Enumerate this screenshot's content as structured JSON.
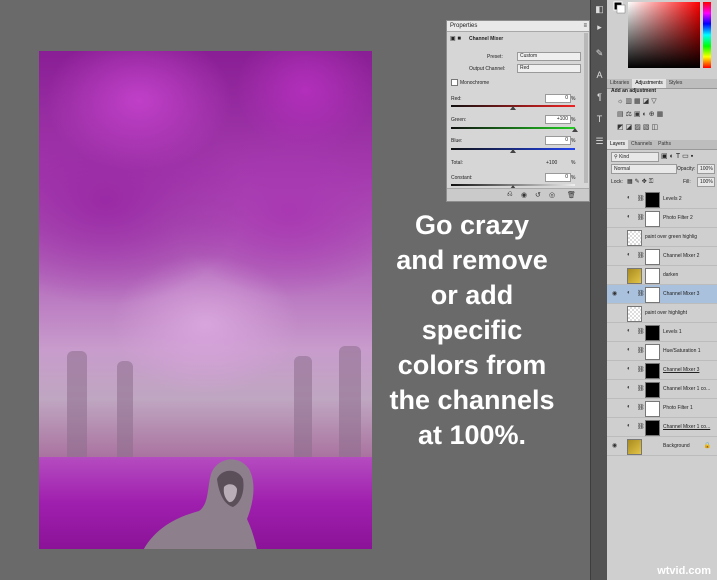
{
  "caption": {
    "lines": [
      "Go crazy",
      "and remove",
      "or add",
      "specific",
      "colors from",
      "the channels",
      "at 100%."
    ]
  },
  "properties": {
    "title": "Properties",
    "panel_name": "Channel Mixer",
    "preset_label": "Preset:",
    "preset_value": "Custom",
    "output_label": "Output Channel:",
    "output_value": "Red",
    "monochrome_label": "Monochrome",
    "red_label": "Red:",
    "red_value": "0",
    "green_label": "Green:",
    "green_value": "+100",
    "blue_label": "Blue:",
    "blue_value": "0",
    "total_label": "Total:",
    "total_value": "+100",
    "constant_label": "Constant:",
    "constant_value": "0",
    "pct": "%",
    "slider_levels": {
      "red": 0.5,
      "green": 1.0,
      "blue": 0.5,
      "constant": 0.5
    }
  },
  "dock": {
    "tabs_top": [
      "Libraries",
      "Adjustments",
      "Styles"
    ],
    "adjust_title": "Add an adjustment",
    "tabs_layers": [
      "Layers",
      "Channels",
      "Paths"
    ],
    "kind_label": "Kind",
    "blend_mode": "Normal",
    "opacity_label": "Opacity:",
    "opacity_value": "100%",
    "lock_label": "Lock:",
    "fill_label": "Fill:",
    "fill_value": "100%",
    "layers": [
      {
        "name": "Levels 2",
        "type": "adjust",
        "thumb": "black",
        "visible": false,
        "selected": false,
        "underline": false
      },
      {
        "name": "Photo Filter 2",
        "type": "adjust",
        "thumb": "white",
        "visible": false,
        "selected": false,
        "underline": false
      },
      {
        "name": "paint over green highlight",
        "type": "pixel",
        "thumb": "checker",
        "visible": false,
        "selected": false,
        "underline": false
      },
      {
        "name": "Channel Mixer 2",
        "type": "adjust",
        "thumb": "white",
        "visible": false,
        "selected": false,
        "underline": false
      },
      {
        "name": "darken",
        "type": "image",
        "thumb": "white",
        "visible": false,
        "selected": false,
        "underline": false
      },
      {
        "name": "Channel Mixer 3",
        "type": "adjust",
        "thumb": "white",
        "visible": true,
        "selected": true,
        "underline": false
      },
      {
        "name": "paint over highlight",
        "type": "pixel",
        "thumb": "checker",
        "visible": false,
        "selected": false,
        "underline": false
      },
      {
        "name": "Levels 1",
        "type": "adjust",
        "thumb": "black",
        "visible": false,
        "selected": false,
        "underline": false
      },
      {
        "name": "Hue/Saturation 1",
        "type": "adjust",
        "thumb": "white",
        "visible": false,
        "selected": false,
        "underline": false
      },
      {
        "name": "Channel Mixer 3",
        "type": "adjust",
        "thumb": "black",
        "visible": false,
        "selected": false,
        "underline": true
      },
      {
        "name": "Channel Mixer 1 co...",
        "type": "adjust",
        "thumb": "black",
        "visible": false,
        "selected": false,
        "underline": false
      },
      {
        "name": "Photo Filter 1",
        "type": "adjust",
        "thumb": "white",
        "visible": false,
        "selected": false,
        "underline": false
      },
      {
        "name": "Channel Mixer 1 co...",
        "type": "adjust",
        "thumb": "black",
        "visible": false,
        "selected": false,
        "underline": true
      },
      {
        "name": "Background",
        "type": "image",
        "thumb": "none",
        "visible": true,
        "selected": false,
        "underline": false
      }
    ]
  },
  "watermark": "wtvid.com",
  "colors": {
    "accent_selected": "#a9c1dd",
    "panel_bg": "#cfcfcf",
    "canvas_bg": "#6a6a6a",
    "magenta": "#a322b0"
  }
}
